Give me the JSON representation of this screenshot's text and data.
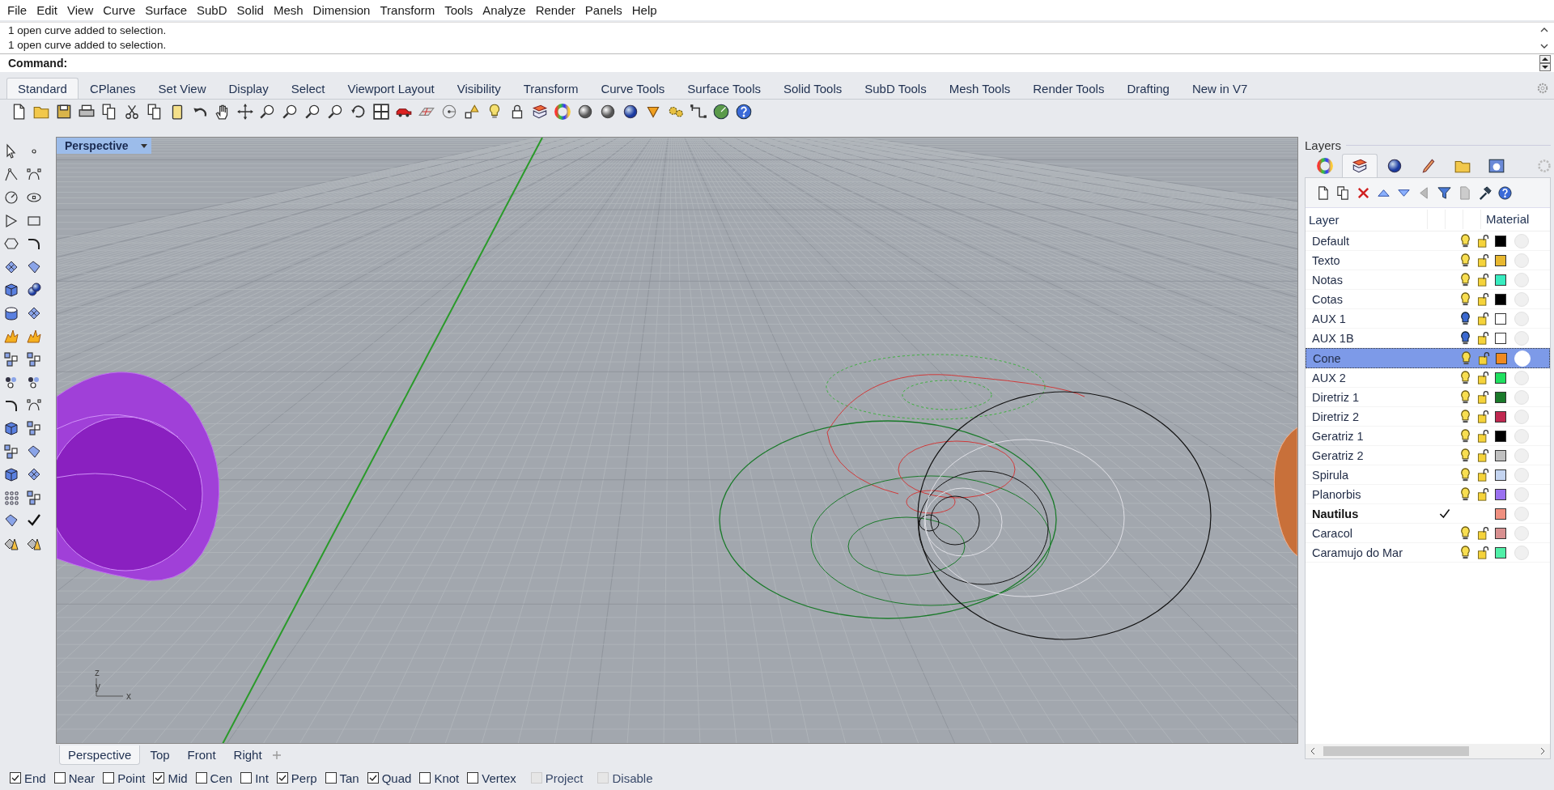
{
  "menu": [
    "File",
    "Edit",
    "View",
    "Curve",
    "Surface",
    "SubD",
    "Solid",
    "Mesh",
    "Dimension",
    "Transform",
    "Tools",
    "Analyze",
    "Render",
    "Panels",
    "Help"
  ],
  "command_history": [
    "1 open curve added to selection.",
    "1 open curve added to selection."
  ],
  "command_prompt": "Command:",
  "toolbar_tabs": [
    {
      "label": "Standard",
      "selected": true
    },
    {
      "label": "CPlanes",
      "selected": false
    },
    {
      "label": "Set View",
      "selected": false
    },
    {
      "label": "Display",
      "selected": false
    },
    {
      "label": "Select",
      "selected": false
    },
    {
      "label": "Viewport Layout",
      "selected": false
    },
    {
      "label": "Visibility",
      "selected": false
    },
    {
      "label": "Transform",
      "selected": false
    },
    {
      "label": "Curve Tools",
      "selected": false
    },
    {
      "label": "Surface Tools",
      "selected": false
    },
    {
      "label": "Solid Tools",
      "selected": false
    },
    {
      "label": "SubD Tools",
      "selected": false
    },
    {
      "label": "Mesh Tools",
      "selected": false
    },
    {
      "label": "Render Tools",
      "selected": false
    },
    {
      "label": "Drafting",
      "selected": false
    },
    {
      "label": "New in V7",
      "selected": false
    }
  ],
  "viewport": {
    "title": "Perspective",
    "axes": {
      "x": "x",
      "y": "y",
      "z": "z"
    }
  },
  "viewport_tabs": [
    {
      "label": "Perspective",
      "selected": true
    },
    {
      "label": "Top",
      "selected": false
    },
    {
      "label": "Front",
      "selected": false
    },
    {
      "label": "Right",
      "selected": false
    }
  ],
  "layers_panel": {
    "title": "Layers",
    "tabs": [
      {
        "kind": "color-wheel",
        "selected": false
      },
      {
        "kind": "layers",
        "selected": true
      },
      {
        "kind": "sphere",
        "selected": false
      },
      {
        "kind": "brush",
        "selected": false
      },
      {
        "kind": "folder",
        "selected": false
      },
      {
        "kind": "help-window",
        "selected": false
      }
    ],
    "columns": [
      "Layer",
      "Material"
    ],
    "layers": [
      {
        "name": "Default",
        "visible": true,
        "locked": false,
        "current": false,
        "selected": false,
        "color": "#000000"
      },
      {
        "name": "Texto",
        "visible": true,
        "locked": false,
        "current": false,
        "selected": false,
        "color": "#e8b830"
      },
      {
        "name": "Notas",
        "visible": true,
        "locked": false,
        "current": false,
        "selected": false,
        "color": "#38ecc0"
      },
      {
        "name": "Cotas",
        "visible": true,
        "locked": false,
        "current": false,
        "selected": false,
        "color": "#000000"
      },
      {
        "name": "AUX 1",
        "visible": false,
        "locked": false,
        "current": false,
        "selected": false,
        "color": "#ffffff"
      },
      {
        "name": "AUX 1B",
        "visible": false,
        "locked": false,
        "current": false,
        "selected": false,
        "color": "#ffffff"
      },
      {
        "name": "Cone",
        "visible": true,
        "locked": false,
        "current": false,
        "selected": true,
        "color": "#f08a20"
      },
      {
        "name": "AUX 2",
        "visible": true,
        "locked": false,
        "current": false,
        "selected": false,
        "color": "#20e060"
      },
      {
        "name": "Diretriz 1",
        "visible": true,
        "locked": false,
        "current": false,
        "selected": false,
        "color": "#1a7a2a"
      },
      {
        "name": "Diretriz 2",
        "visible": true,
        "locked": false,
        "current": false,
        "selected": false,
        "color": "#c02850"
      },
      {
        "name": "Geratriz 1",
        "visible": true,
        "locked": false,
        "current": false,
        "selected": false,
        "color": "#000000"
      },
      {
        "name": "Geratriz 2",
        "visible": true,
        "locked": false,
        "current": false,
        "selected": false,
        "color": "#c0c0c0"
      },
      {
        "name": "Spirula",
        "visible": true,
        "locked": false,
        "current": false,
        "selected": false,
        "color": "#c4d4f0"
      },
      {
        "name": "Planorbis",
        "visible": true,
        "locked": false,
        "current": false,
        "selected": false,
        "color": "#9a70f0"
      },
      {
        "name": "Nautilus",
        "current": true,
        "selected": false,
        "color": "#f09080"
      },
      {
        "name": "Caracol",
        "visible": true,
        "locked": false,
        "current": false,
        "selected": false,
        "color": "#d89090"
      },
      {
        "name": "Caramujo do Mar",
        "visible": true,
        "locked": false,
        "current": false,
        "selected": false,
        "color": "#50f0a8"
      }
    ]
  },
  "snaps": [
    {
      "label": "End",
      "checked": true,
      "disabled": false
    },
    {
      "label": "Near",
      "checked": false,
      "disabled": false
    },
    {
      "label": "Point",
      "checked": false,
      "disabled": false
    },
    {
      "label": "Mid",
      "checked": true,
      "disabled": false
    },
    {
      "label": "Cen",
      "checked": false,
      "disabled": false
    },
    {
      "label": "Int",
      "checked": false,
      "disabled": false
    },
    {
      "label": "Perp",
      "checked": true,
      "disabled": false
    },
    {
      "label": "Tan",
      "checked": false,
      "disabled": false
    },
    {
      "label": "Quad",
      "checked": true,
      "disabled": false
    },
    {
      "label": "Knot",
      "checked": false,
      "disabled": false
    },
    {
      "label": "Vertex",
      "checked": false,
      "disabled": false
    },
    {
      "label": "Project",
      "checked": false,
      "disabled": true
    },
    {
      "label": "Disable",
      "checked": false,
      "disabled": true
    }
  ]
}
